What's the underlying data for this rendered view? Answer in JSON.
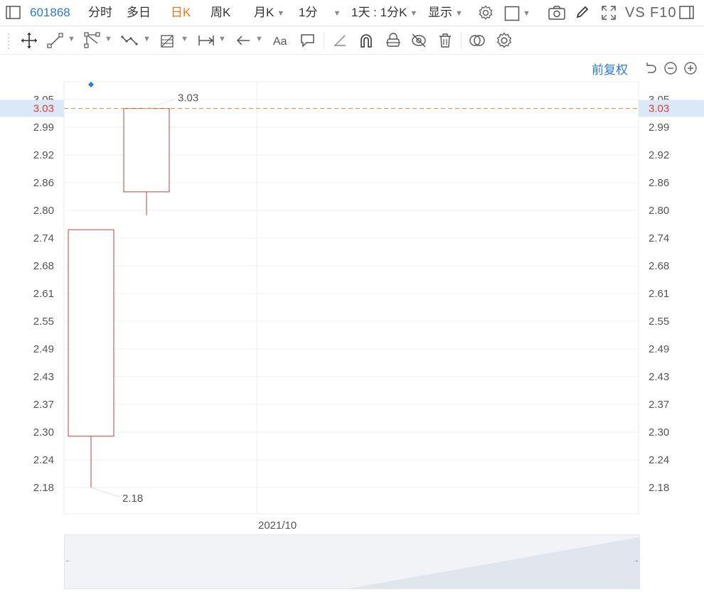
{
  "toolbar_top": {
    "stock_code": "601868",
    "tabs": [
      "分时",
      "多日",
      "日K",
      "周K",
      "月K"
    ],
    "active_tab": "日K",
    "interval": "1分",
    "range": "1天 : 1分K",
    "display": "显示",
    "vs_label": "VS",
    "f10_label": "F10"
  },
  "adjust_label": "前复权",
  "colors": {
    "accent_blue": "#2b7bd6",
    "active_orange": "#f07a15",
    "candle_red": "#c8403a",
    "current_line": "#ef8a4a"
  },
  "current_price": "3.03",
  "chart_data": {
    "type": "candlestick",
    "x_label": "2021/10",
    "y_ticks": [
      "2.18",
      "2.24",
      "2.30",
      "2.37",
      "2.43",
      "2.49",
      "2.55",
      "2.61",
      "2.68",
      "2.74",
      "2.80",
      "2.86",
      "2.92",
      "2.99",
      "3.05"
    ],
    "ylim": [
      2.18,
      3.05
    ],
    "candles": [
      {
        "open": 2.295,
        "close": 2.758,
        "high": 2.758,
        "low": 2.18
      },
      {
        "open": 2.843,
        "close": 3.03,
        "high": 3.03,
        "low": 2.79
      }
    ],
    "annotations": {
      "max_label": "3.03",
      "min_label": "2.18"
    },
    "current_price": 3.03,
    "grid": true
  }
}
